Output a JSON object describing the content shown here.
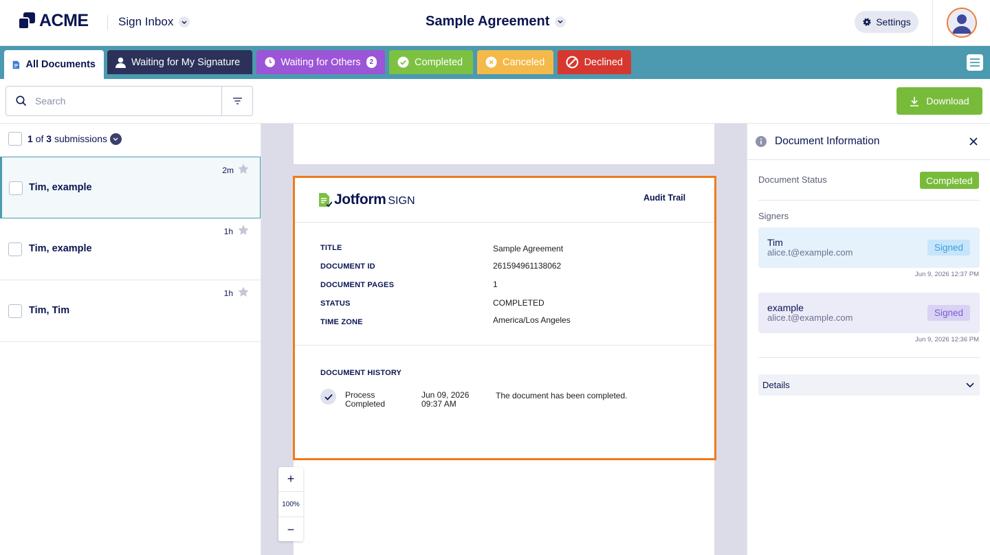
{
  "header": {
    "brand": "ACME",
    "inbox_label": "Sign Inbox",
    "document_title": "Sample Agreement",
    "settings_label": "Settings"
  },
  "tabs": [
    {
      "label": "All Documents",
      "bg": "#ffffff",
      "fg": "#0a1551"
    },
    {
      "label": "Waiting for My Signature",
      "bg": "#2b3159",
      "fg": "#ffffff"
    },
    {
      "label": "Waiting for Others",
      "badge": "2",
      "bg": "#9b55d6",
      "fg": "#ffffff"
    },
    {
      "label": "Completed",
      "bg": "#7dc142",
      "fg": "#ffffff"
    },
    {
      "label": "Canceled",
      "bg": "#f5b94a",
      "fg": "#ffffff"
    },
    {
      "label": "Declined",
      "bg": "#d6382f",
      "fg": "#ffffff"
    }
  ],
  "toolbar": {
    "search_placeholder": "Search",
    "download_label": "Download"
  },
  "submissions": {
    "current": "1",
    "of_label": "of",
    "total": "3",
    "suffix": "submissions",
    "items": [
      {
        "name": "Tim, example",
        "time": "2m"
      },
      {
        "name": "Tim, example",
        "time": "1h"
      },
      {
        "name": "Tim, Tim",
        "time": "1h"
      }
    ]
  },
  "audit": {
    "brand_main": "Jotform",
    "brand_sub": "SIGN",
    "heading": "Audit Trail",
    "fields": [
      {
        "label": "TITLE",
        "value": "Sample Agreement"
      },
      {
        "label": "DOCUMENT ID",
        "value": "261594961138062"
      },
      {
        "label": "DOCUMENT PAGES",
        "value": "1"
      },
      {
        "label": "STATUS",
        "value": "COMPLETED"
      },
      {
        "label": "TIME ZONE",
        "value": "America/Los Angeles"
      }
    ],
    "history_heading": "DOCUMENT HISTORY",
    "history": [
      {
        "event_line1": "Process",
        "event_line2": "Completed",
        "date_line1": "Jun 09, 2026",
        "date_line2": "09:37 AM",
        "description": "The document has been completed."
      }
    ]
  },
  "zoom": {
    "plus": "+",
    "level": "100%",
    "minus": "−"
  },
  "info_panel": {
    "title": "Document Information",
    "status_label": "Document Status",
    "status_value": "Completed",
    "signers_label": "Signers",
    "signers": [
      {
        "name": "Tim",
        "email": "alice.t@example.com",
        "status": "Signed",
        "date": "Jun 9, 2026 12:37 PM"
      },
      {
        "name": "example",
        "email": "alice.t@example.com",
        "status": "Signed",
        "date": "Jun 9, 2026 12:36 PM"
      }
    ],
    "details_label": "Details"
  },
  "colors": {
    "tab_bar": "#4b9ab0",
    "accent_orange": "#f07a1a",
    "completed_green": "#78bb3a",
    "navy": "#0a1551"
  },
  "icons": [
    "acme-logo-icon",
    "chevron-down-icon",
    "gear-icon",
    "avatar-icon",
    "document-icon",
    "user-icon",
    "clock-icon",
    "check-circle-icon",
    "x-circle-icon",
    "ban-icon",
    "hamburger-icon",
    "search-icon",
    "filter-icon",
    "download-icon",
    "star-icon",
    "info-icon",
    "close-icon",
    "check-icon",
    "jotform-sign-logo"
  ]
}
